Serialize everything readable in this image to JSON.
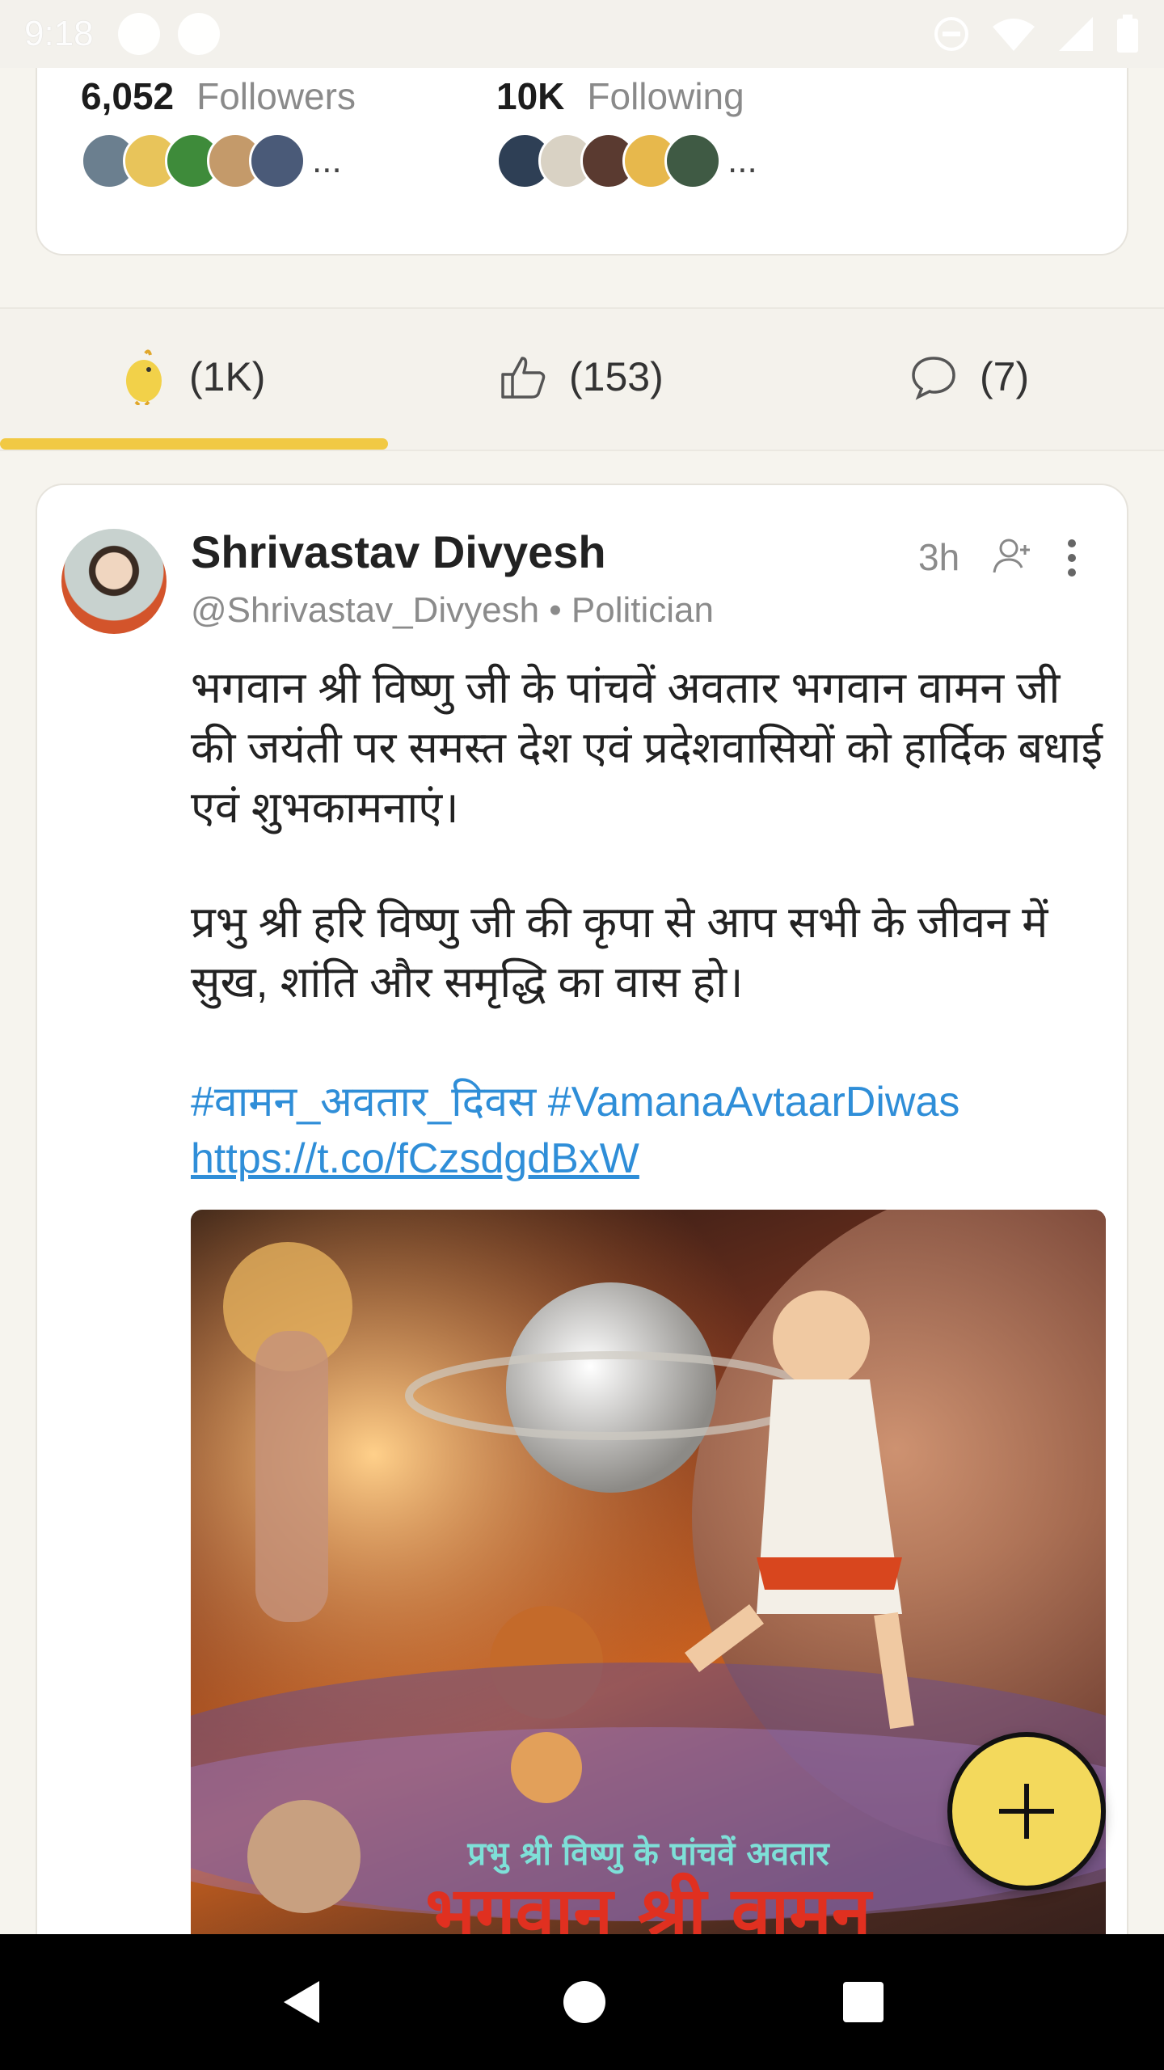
{
  "status_bar": {
    "time": "9:18"
  },
  "profile": {
    "followers_count": "6,052",
    "followers_label": "Followers",
    "following_count": "10K",
    "following_label": "Following",
    "more": "..."
  },
  "tabs": [
    {
      "label": "(1K)",
      "icon": "koo-bird-icon"
    },
    {
      "label": "(153)",
      "icon": "thumbs-up-icon"
    },
    {
      "label": "(7)",
      "icon": "comment-icon"
    }
  ],
  "post": {
    "author_name": "Shrivastav Divyesh",
    "handle": "@Shrivastav_Divyesh",
    "role": "• Politician",
    "time": "3h",
    "paragraph1": "भगवान श्री विष्णु जी के पांचवें अवतार भगवान वामन जी की जयंती पर समस्त देश एवं प्रदेशवासियों को हार्दिक बधाई एवं शुभकामनाएं।",
    "paragraph2": "प्रभु श्री हरि विष्णु जी की कृपा से आप सभी के जीवन में सुख, शांति और समृद्धि का वास हो।",
    "hashtags": "#वामन_अवतार_दिवस #VamanaAvtaarDiwas",
    "link": "https://t.co/fCzsdgdBxW",
    "image_caption": "प्रभु श्री विष्णु के पांचवें अवतार",
    "image_title": "भगवान श्री वामन"
  },
  "colors": {
    "accent_yellow": "#f1c944",
    "link_blue": "#2f8ed8",
    "fab_yellow": "#f3d95c"
  }
}
